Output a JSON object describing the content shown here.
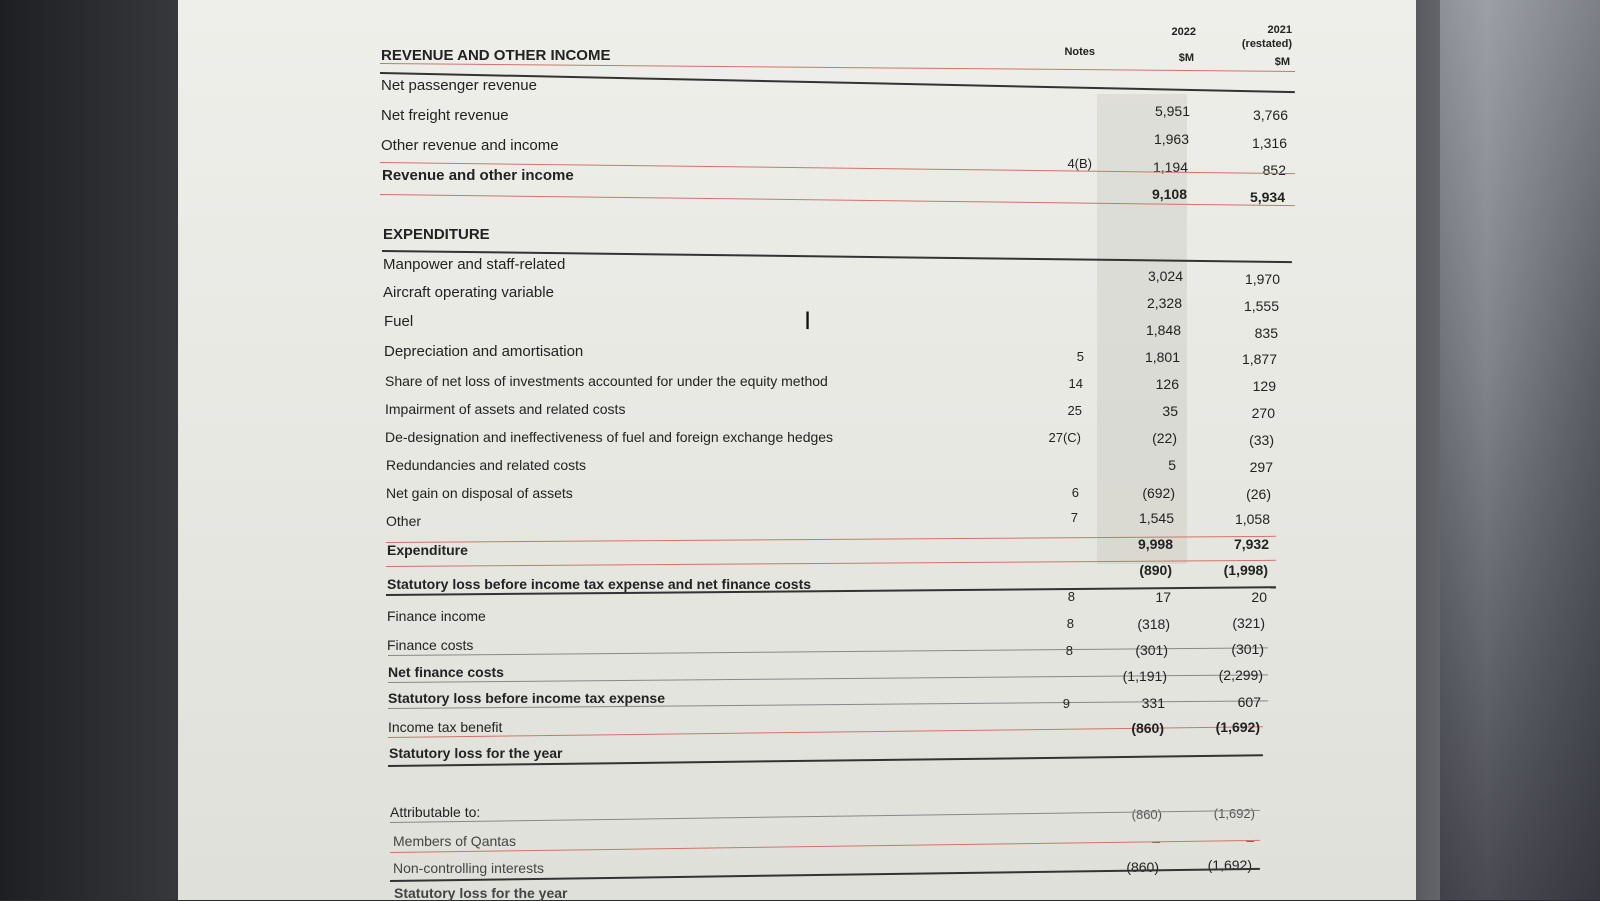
{
  "header": {
    "notes": "Notes",
    "y2022": "2022",
    "y2022_unit": "$M",
    "y2021": "2021",
    "y2021_sub": "(restated)",
    "y2021_unit": "$M"
  },
  "revenue": {
    "title": "REVENUE AND OTHER INCOME",
    "rows": [
      {
        "label": "Net passenger revenue",
        "notes": "",
        "v2022": "5,951",
        "v2021": "3,766"
      },
      {
        "label": "Net freight revenue",
        "notes": "",
        "v2022": "1,963",
        "v2021": "1,316"
      },
      {
        "label": "Other revenue and income",
        "notes": "4(B)",
        "v2022": "1,194",
        "v2021": "852"
      },
      {
        "label": "Revenue and other income",
        "notes": "",
        "v2022": "9,108",
        "v2021": "5,934"
      }
    ]
  },
  "expenditure": {
    "title": "EXPENDITURE",
    "rows": [
      {
        "label": "Manpower and staff-related",
        "notes": "",
        "v2022": "3,024",
        "v2021": "1,970"
      },
      {
        "label": "Aircraft operating variable",
        "notes": "",
        "v2022": "2,328",
        "v2021": "1,555"
      },
      {
        "label": "Fuel",
        "notes": "",
        "v2022": "1,848",
        "v2021": "835"
      },
      {
        "label": "Depreciation and amortisation",
        "notes": "5",
        "v2022": "1,801",
        "v2021": "1,877"
      },
      {
        "label": "Share of net loss of investments accounted for under the equity method",
        "notes": "14",
        "v2022": "126",
        "v2021": "129"
      },
      {
        "label": "Impairment of assets and related costs",
        "notes": "25",
        "v2022": "35",
        "v2021": "270"
      },
      {
        "label": "De-designation and ineffectiveness of fuel and foreign exchange hedges",
        "notes": "27(C)",
        "v2022": "(22)",
        "v2021": "(33)"
      },
      {
        "label": "Redundancies and related costs",
        "notes": "",
        "v2022": "5",
        "v2021": "297"
      },
      {
        "label": "Net gain on disposal of assets",
        "notes": "6",
        "v2022": "(692)",
        "v2021": "(26)"
      },
      {
        "label": "Other",
        "notes": "7",
        "v2022": "1,545",
        "v2021": "1,058"
      },
      {
        "label": "Expenditure",
        "notes": "",
        "v2022": "9,998",
        "v2021": "7,932"
      }
    ]
  },
  "results": {
    "rows": [
      {
        "label": "Statutory loss before income tax expense and net finance costs",
        "notes": "",
        "v2022": "(890)",
        "v2021": "(1,998)"
      },
      {
        "label": "Finance income",
        "notes": "8",
        "v2022": "17",
        "v2021": "20"
      },
      {
        "label": "Finance costs",
        "notes": "8",
        "v2022": "(318)",
        "v2021": "(321)"
      },
      {
        "label": "Net finance costs",
        "notes": "8",
        "v2022": "(301)",
        "v2021": "(301)"
      },
      {
        "label": "Statutory loss before income tax expense",
        "notes": "",
        "v2022": "(1,191)",
        "v2021": "(2,299)"
      },
      {
        "label": "Income tax benefit",
        "notes": "9",
        "v2022": "331",
        "v2021": "607"
      },
      {
        "label": "Statutory loss for the year",
        "notes": "",
        "v2022": "(860)",
        "v2021": "(1,692)"
      }
    ]
  },
  "attributable": {
    "title": "Attributable to:",
    "title_v2022": "(860)",
    "title_v2021": "(1,692)",
    "rows": [
      {
        "label": "Members of Qantas",
        "v2022": "–",
        "v2021": "–"
      },
      {
        "label": "Non-controlling interests",
        "v2022": "(860)",
        "v2021": "(1,692)"
      },
      {
        "label": "Statutory loss for the year",
        "v2022": "",
        "v2021": ""
      }
    ]
  }
}
